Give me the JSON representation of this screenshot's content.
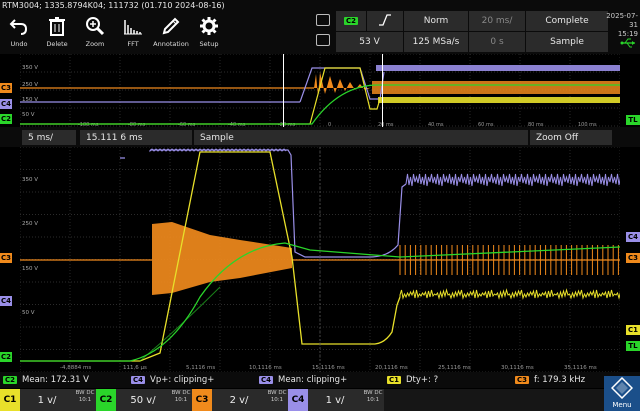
{
  "title_bar": {
    "text": "RTM3004; 1335.8794K04; 111732 (01.710 2024-08-16)"
  },
  "toolbar": [
    {
      "label": "Undo",
      "icon": "undo-icon"
    },
    {
      "label": "Delete",
      "icon": "trash-icon"
    },
    {
      "label": "Zoom",
      "icon": "zoom-icon"
    },
    {
      "label": "FFT",
      "icon": "fft-icon"
    },
    {
      "label": "Annotation",
      "icon": "pen-icon"
    },
    {
      "label": "Setup",
      "icon": "gear-icon"
    }
  ],
  "acquisition": {
    "trigger_source": "C2",
    "trigger_slope": "rising-edge",
    "trigger_mode": "Norm",
    "time_scale": "20 ms/",
    "acq_state": "Complete",
    "trigger_level": "53 V",
    "sample_rate": "125 MSa/s",
    "horizontal_position": "0 s",
    "acq_mode": "Sample"
  },
  "datetime": {
    "date": "2025-07-31",
    "time": "15:19"
  },
  "overview": {
    "labels": [
      "350 V",
      "250 V",
      "150 V",
      "50 V",
      "C3",
      "C4",
      "C2"
    ],
    "time_ticks": [
      "-100 ms",
      "-80 ms",
      "-60 ms",
      "-40 ms",
      "-20 ms",
      "0",
      "20 ms",
      "40 ms",
      "60 ms",
      "80 ms",
      "100 ms"
    ],
    "right_tag": "TL"
  },
  "zoom_bar": {
    "time_scale": "5 ms/",
    "position": "15.111 6 ms",
    "acq_mode": "Sample",
    "zoom_button": "Zoom Off"
  },
  "main": {
    "labels": [
      "350 V",
      "250 V",
      "150 V",
      "50 V"
    ],
    "time_ticks": [
      "-4,8884 ms",
      "111,6 µs",
      "5,1116 ms",
      "10,1116 ms",
      "15,1116 ms",
      "20,1116 ms",
      "25,1116 ms",
      "30,1116 ms",
      "35,1116 ms",
      "40,1116 ms"
    ],
    "left_marks": [
      "C3",
      "C4",
      "C2"
    ],
    "right_marks": [
      "C3",
      "C4",
      "C1",
      "TL"
    ]
  },
  "measurements": [
    {
      "ch": "C2",
      "text": "Mean: 172.31 V",
      "color": "#2ad52a"
    },
    {
      "ch": "C4",
      "text": "Vp+: clipping+",
      "color": "#9a8fe8"
    },
    {
      "ch": "C4",
      "text": "Mean: clipping+",
      "color": "#9a8fe8"
    },
    {
      "ch": "C1",
      "text": "Dty+: ?",
      "color": "#e8e02a"
    },
    {
      "ch": "C3",
      "text": "f: 179.3 kHz",
      "color": "#f08a1c"
    }
  ],
  "channels": [
    {
      "ch": "C1",
      "scale": "1 v/",
      "coupling_top": "BW DC",
      "coupling_bot": "10:1",
      "color": "#e8e02a"
    },
    {
      "ch": "C2",
      "scale": "50 v/",
      "coupling_top": "BW DC",
      "coupling_bot": "10:1",
      "color": "#2ad52a"
    },
    {
      "ch": "C3",
      "scale": "2 v/",
      "coupling_top": "BW DC",
      "coupling_bot": "10:1",
      "color": "#f08a1c"
    },
    {
      "ch": "C4",
      "scale": "1 v/",
      "coupling_top": "BW DC",
      "coupling_bot": "10:1",
      "color": "#9a8fe8"
    }
  ],
  "menu": {
    "label": "Menu"
  },
  "colors": {
    "c1": "#e8e02a",
    "c2": "#2ad52a",
    "c3": "#f08a1c",
    "c4": "#9a8fe8",
    "grid": "#3a3a3a"
  }
}
